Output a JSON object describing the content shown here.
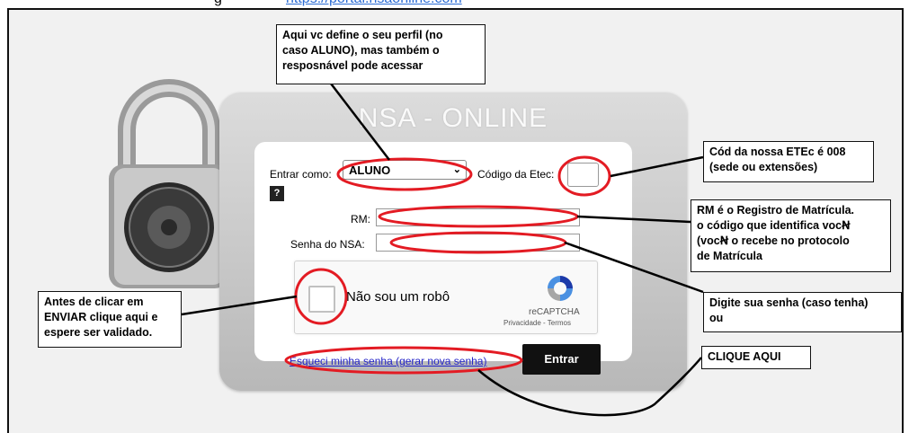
{
  "top_strip": {
    "prefix": "g",
    "link": "https://portal.nsaonline.com"
  },
  "login": {
    "brand": "NSA - ONLINE",
    "entrar_como_label": "Entrar como:",
    "profile_selected": "ALUNO",
    "codigo_label": "Código da Etec:",
    "help_label": "?",
    "rm_label": "RM:",
    "senha_label": "Senha do NSA:",
    "captcha_text": "Não sou um robô",
    "captcha_brand": "reCAPTCHA",
    "captcha_terms": "Privacidade - Termos",
    "forgot_link": "Esqueci minha senha (gerar nova senha)",
    "enter_button": "Entrar"
  },
  "annotations": {
    "perfil": [
      "Aqui vc define o seu perfil (no",
      "caso ALUNO), mas também o",
      "resposnável pode acessar"
    ],
    "etec": [
      "Cód da nossa ETEc é 008",
      "(sede ou extensões)"
    ],
    "rm": [
      "RM é o Registro de Matrícula.",
      "o código que identifica vocꞤ",
      "(vocꞤ o recebe no protocolo",
      "de Matrícula"
    ],
    "senha": [
      "Digite sua senha (caso tenha)",
      "ou"
    ],
    "captcha": [
      "Antes de clicar em",
      "ENVIAR clique aqui e",
      "espere ser validado."
    ],
    "clique": [
      "CLIQUE AQUI"
    ]
  },
  "colors": {
    "highlight_ellipse": "#e31b23",
    "button_dark": "#111111",
    "link": "#2323c8"
  }
}
